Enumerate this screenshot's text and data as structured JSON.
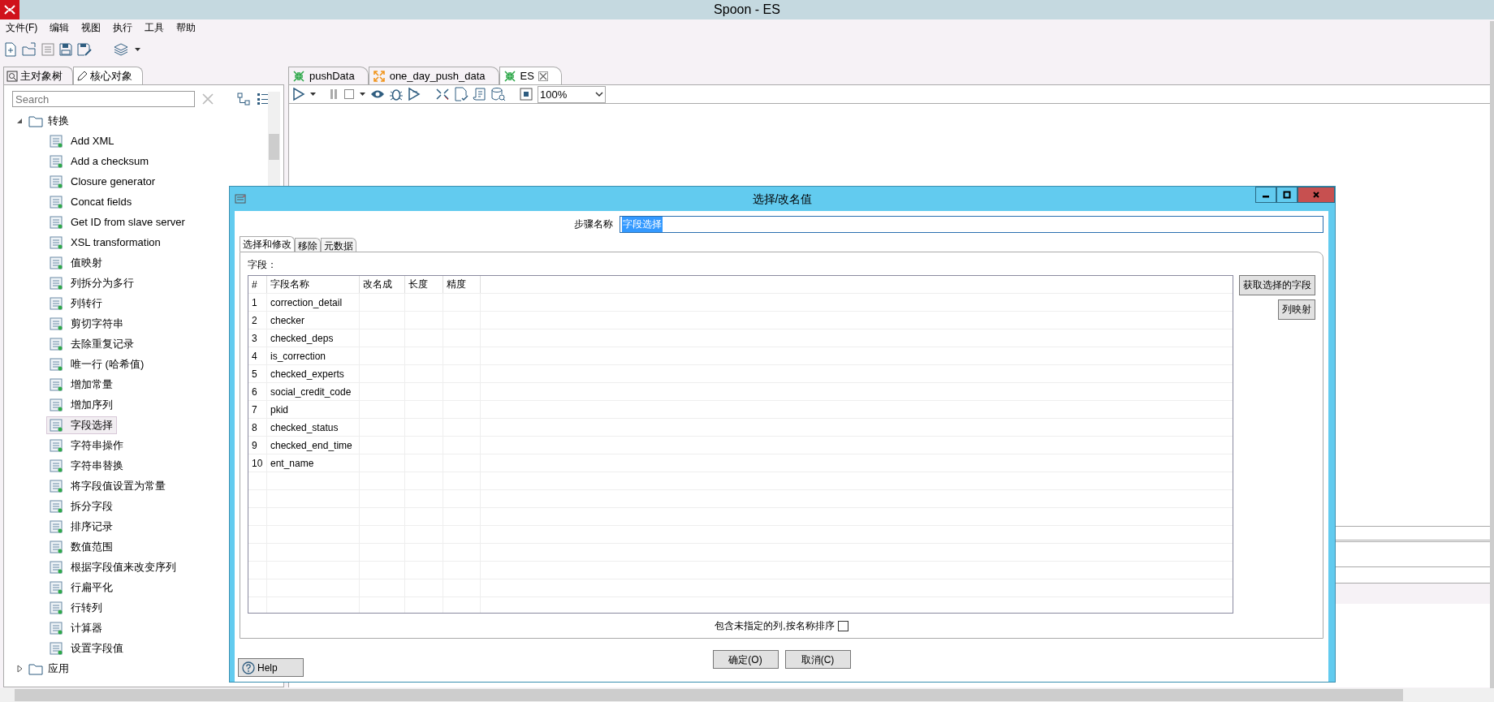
{
  "window": {
    "title": "Spoon - ES"
  },
  "menu": [
    "文件(F)",
    "编辑",
    "视图",
    "执行",
    "工具",
    "帮助"
  ],
  "sidebar": {
    "tabs": [
      {
        "label": "主对象树",
        "selected": false
      },
      {
        "label": "核心对象",
        "selected": true
      }
    ],
    "search": {
      "placeholder": "Search"
    },
    "tree": [
      {
        "label": "转换",
        "expanded": true,
        "children": [
          {
            "label": "Add XML",
            "selected": false
          },
          {
            "label": "Add a checksum",
            "selected": false
          },
          {
            "label": "Closure generator",
            "selected": false
          },
          {
            "label": "Concat fields",
            "selected": false
          },
          {
            "label": "Get ID from slave server",
            "selected": false
          },
          {
            "label": "XSL transformation",
            "selected": false
          },
          {
            "label": "值映射",
            "selected": false
          },
          {
            "label": "列拆分为多行",
            "selected": false
          },
          {
            "label": "列转行",
            "selected": false
          },
          {
            "label": "剪切字符串",
            "selected": false
          },
          {
            "label": "去除重复记录",
            "selected": false
          },
          {
            "label": "唯一行 (哈希值)",
            "selected": false
          },
          {
            "label": "增加常量",
            "selected": false
          },
          {
            "label": "增加序列",
            "selected": false
          },
          {
            "label": "字段选择",
            "selected": true
          },
          {
            "label": "字符串操作",
            "selected": false
          },
          {
            "label": "字符串替换",
            "selected": false
          },
          {
            "label": "将字段值设置为常量",
            "selected": false
          },
          {
            "label": "拆分字段",
            "selected": false
          },
          {
            "label": "排序记录",
            "selected": false
          },
          {
            "label": "数值范围",
            "selected": false
          },
          {
            "label": "根据字段值来改变序列",
            "selected": false
          },
          {
            "label": "行扁平化",
            "selected": false
          },
          {
            "label": "行转列",
            "selected": false
          },
          {
            "label": "计算器",
            "selected": false
          },
          {
            "label": "设置字段值",
            "selected": false
          }
        ]
      },
      {
        "label": "应用",
        "expanded": false
      }
    ]
  },
  "editor": {
    "tabs": [
      {
        "label": "pushData",
        "kind": "transformation",
        "selected": false
      },
      {
        "label": "one_day_push_data",
        "kind": "job",
        "selected": false
      },
      {
        "label": "ES",
        "kind": "transformation",
        "selected": true
      }
    ],
    "zoom": "100%"
  },
  "dialog": {
    "title": "选择/改名值",
    "step_name_label": "步骤名称",
    "step_name": "字段选择",
    "tabs": [
      {
        "label": "选择和修改",
        "selected": true
      },
      {
        "label": "移除",
        "selected": false
      },
      {
        "label": "元数据",
        "selected": false
      }
    ],
    "fields_label": "字段：",
    "table": {
      "columns": [
        "#",
        "字段名称",
        "改名成",
        "长度",
        "精度"
      ],
      "rows": [
        {
          "num": "1",
          "name": "correction_detail"
        },
        {
          "num": "2",
          "name": "checker"
        },
        {
          "num": "3",
          "name": "checked_deps"
        },
        {
          "num": "4",
          "name": "is_correction"
        },
        {
          "num": "5",
          "name": "checked_experts"
        },
        {
          "num": "6",
          "name": "social_credit_code"
        },
        {
          "num": "7",
          "name": "pkid"
        },
        {
          "num": "8",
          "name": "checked_status"
        },
        {
          "num": "9",
          "name": "checked_end_time"
        },
        {
          "num": "10",
          "name": "ent_name"
        }
      ]
    },
    "side_buttons": [
      "获取选择的字段",
      "列映射"
    ],
    "include_unspecified": {
      "label": "包含未指定的列,按名称排序",
      "checked": false
    },
    "buttons": [
      "确定(O)",
      "取消(C)"
    ],
    "help": "Help"
  }
}
